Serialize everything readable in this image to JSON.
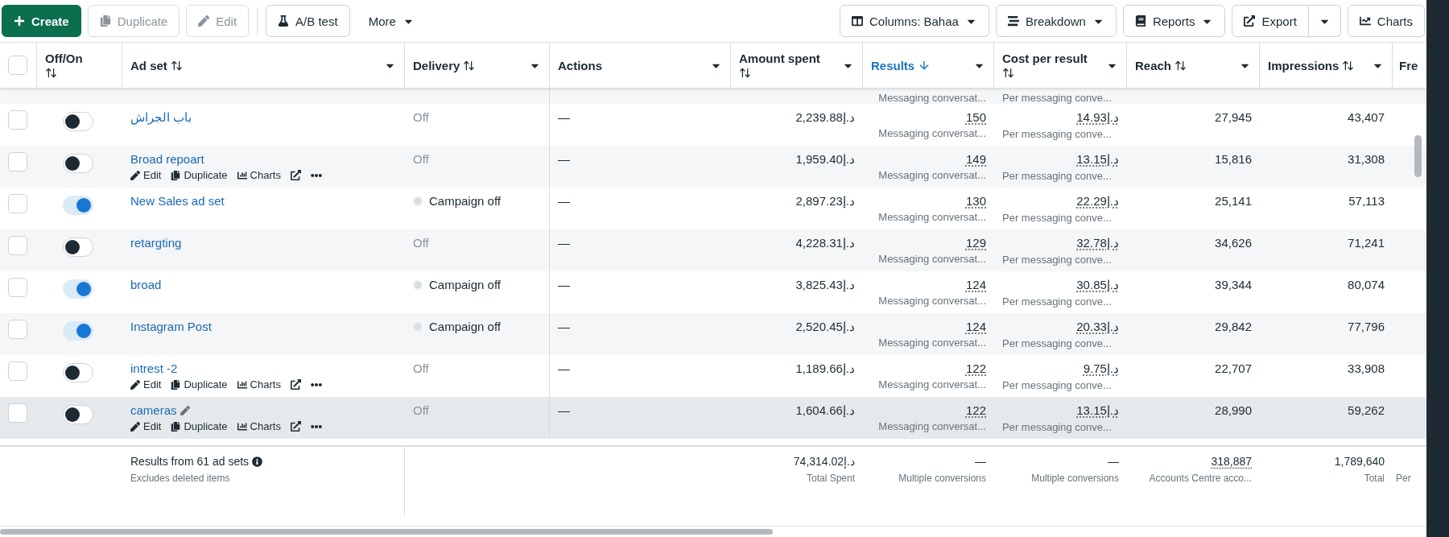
{
  "toolbar": {
    "left": [
      {
        "label": "Create",
        "kind": "create",
        "disabled": false
      },
      {
        "label": "Duplicate",
        "kind": "duplicate",
        "disabled": true
      },
      {
        "label": "Edit",
        "kind": "edit",
        "disabled": true
      },
      {
        "label": "A/B test",
        "kind": "abtest",
        "disabled": false
      }
    ],
    "more": "More",
    "right": [
      {
        "label": "Columns: Bahaa",
        "kind": "columns"
      },
      {
        "label": "Breakdown",
        "kind": "breakdown"
      },
      {
        "label": "Reports",
        "kind": "reports"
      },
      {
        "label": "Export",
        "kind": "export"
      },
      {
        "label": "Charts",
        "kind": "charts"
      }
    ]
  },
  "columns": [
    {
      "label": "Off/On",
      "sorted": false,
      "menu": false
    },
    {
      "label": "Ad set",
      "sorted": false,
      "menu": true
    },
    {
      "label": "Delivery",
      "sorted": false,
      "menu": true
    },
    {
      "label": "Actions",
      "menu": true
    },
    {
      "label": "Amount spent",
      "sorted": false,
      "menu": true
    },
    {
      "label": "Results",
      "sorted": true,
      "menu": true
    },
    {
      "label": "Cost per result",
      "sorted": false,
      "menu": true
    },
    {
      "label": "Reach",
      "sorted": false,
      "menu": true
    },
    {
      "label": "Impressions",
      "sorted": false,
      "menu": true
    },
    {
      "label": "Fre",
      "menu": false
    }
  ],
  "select_all_checked": false,
  "cut_row": {
    "results_sub": "Messaging conversat...",
    "cost_sub": "Per messaging conve..."
  },
  "rows": [
    {
      "name": "باب الجراش",
      "checked": false,
      "on": false,
      "edited": false,
      "highlighted": false,
      "delivery": {
        "text": "Off",
        "dot": false
      },
      "actions_col": "—",
      "spent": "2,239.88د.إ",
      "results": "150",
      "results_sub": "Messaging conversat...",
      "cost": "14.93د.إ",
      "cost_sub": "Per messaging conve...",
      "reach": "27,945",
      "impressions": "43,407"
    },
    {
      "name": "Broad repoart",
      "checked": false,
      "on": false,
      "edited": false,
      "highlighted": false,
      "actions": [
        "Edit",
        "Duplicate",
        "Charts"
      ],
      "delivery": {
        "text": "Off",
        "dot": false
      },
      "actions_col": "—",
      "spent": "1,959.40د.إ",
      "results": "149",
      "results_sub": "Messaging conversat...",
      "cost": "13.15د.إ",
      "cost_sub": "Per messaging conve...",
      "reach": "15,816",
      "impressions": "31,308"
    },
    {
      "name": "New Sales ad set",
      "checked": false,
      "on": true,
      "edited": false,
      "highlighted": false,
      "delivery": {
        "text": "Campaign off",
        "dot": true
      },
      "actions_col": "—",
      "spent": "2,897.23د.إ",
      "results": "130",
      "results_sub": "Messaging conversat...",
      "cost": "22.29د.إ",
      "cost_sub": "Per messaging conve...",
      "reach": "25,141",
      "impressions": "57,113"
    },
    {
      "name": "retargting",
      "checked": false,
      "on": false,
      "edited": false,
      "highlighted": false,
      "delivery": {
        "text": "Off",
        "dot": false
      },
      "actions_col": "—",
      "spent": "4,228.31د.إ",
      "results": "129",
      "results_sub": "Messaging conversat...",
      "cost": "32.78د.إ",
      "cost_sub": "Per messaging conve...",
      "reach": "34,626",
      "impressions": "71,241"
    },
    {
      "name": "broad",
      "checked": false,
      "on": true,
      "edited": false,
      "highlighted": false,
      "delivery": {
        "text": "Campaign off",
        "dot": true
      },
      "actions_col": "—",
      "spent": "3,825.43د.إ",
      "results": "124",
      "results_sub": "Messaging conversat...",
      "cost": "30.85د.إ",
      "cost_sub": "Per messaging conve...",
      "reach": "39,344",
      "impressions": "80,074"
    },
    {
      "name": "Instagram Post",
      "checked": false,
      "on": true,
      "edited": false,
      "highlighted": false,
      "delivery": {
        "text": "Campaign off",
        "dot": true
      },
      "actions_col": "—",
      "spent": "2,520.45د.إ",
      "results": "124",
      "results_sub": "Messaging conversat...",
      "cost": "20.33د.إ",
      "cost_sub": "Per messaging conve...",
      "reach": "29,842",
      "impressions": "77,796"
    },
    {
      "name": "intrest -2",
      "checked": false,
      "on": false,
      "edited": false,
      "highlighted": false,
      "actions": [
        "Edit",
        "Duplicate",
        "Charts"
      ],
      "delivery": {
        "text": "Off",
        "dot": false
      },
      "actions_col": "—",
      "spent": "1,189.66د.إ",
      "results": "122",
      "results_sub": "Messaging conversat...",
      "cost": "9.75د.إ",
      "cost_sub": "Per messaging conve...",
      "reach": "22,707",
      "impressions": "33,908"
    },
    {
      "name": "cameras",
      "checked": false,
      "on": false,
      "edited": true,
      "highlighted": true,
      "actions": [
        "Edit",
        "Duplicate",
        "Charts"
      ],
      "delivery": {
        "text": "Off",
        "dot": false
      },
      "actions_col": "—",
      "spent": "1,604.66د.إ",
      "results": "122",
      "results_sub": "Messaging conversat...",
      "cost": "13.15د.إ",
      "cost_sub": "Per messaging conve...",
      "reach": "28,990",
      "impressions": "59,262"
    }
  ],
  "footer": {
    "title": "Results from 61 ad sets",
    "subtitle": "Excludes deleted items",
    "cells": [
      {
        "value": "74,314.02د.إ",
        "label": "Total Spent",
        "dotted": false
      },
      {
        "value": "—",
        "label": "Multiple conversions",
        "dotted": false
      },
      {
        "value": "—",
        "label": "Multiple conversions",
        "dotted": false
      },
      {
        "value": "318,887",
        "label": "Accounts Centre acco...",
        "dotted": true
      },
      {
        "value": "1,789,640",
        "label": "Total",
        "dotted": false
      }
    ],
    "cut_label": "Per"
  }
}
